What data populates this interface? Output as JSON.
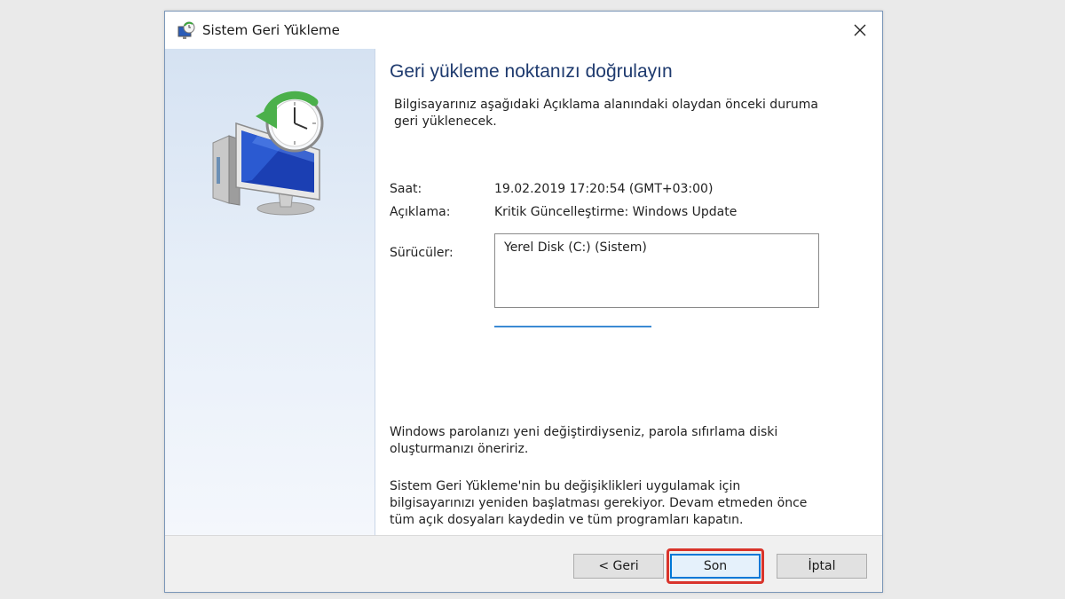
{
  "window": {
    "title": "Sistem Geri Yükleme",
    "close_glyph": "✕"
  },
  "content": {
    "heading": "Geri yükleme noktanızı doğrulayın",
    "intro": "Bilgisayarınız aşağıdaki Açıklama alanındaki olaydan önceki duruma geri yüklenecek.",
    "fields": {
      "time_label": "Saat:",
      "time_value": "19.02.2019 17:20:54 (GMT+03:00)",
      "description_label": "Açıklama:",
      "description_value": "Kritik Güncelleştirme: Windows Update",
      "drives_label": "Sürücüler:",
      "drives": [
        "Yerel Disk (C:) (Sistem)"
      ]
    },
    "note_password": "Windows parolanızı yeni değiştirdiyseniz, parola sıfırlama diski oluşturmanızı öneririz.",
    "note_restart": "Sistem Geri Yükleme'nin bu değişiklikleri uygulamak için bilgisayarınızı yeniden başlatması gerekiyor. Devam etmeden önce tüm açık dosyaları kaydedin ve tüm programları kapatın."
  },
  "footer": {
    "back_label": "< Geri",
    "finish_label": "Son",
    "cancel_label": "İptal"
  },
  "icons": {
    "title_icon": "system-restore-icon",
    "hero_icon": "system-restore-monitor-clock-icon"
  },
  "colors": {
    "heading": "#1e3a6e",
    "accent": "#0078d7",
    "highlight": "#d9342b"
  }
}
